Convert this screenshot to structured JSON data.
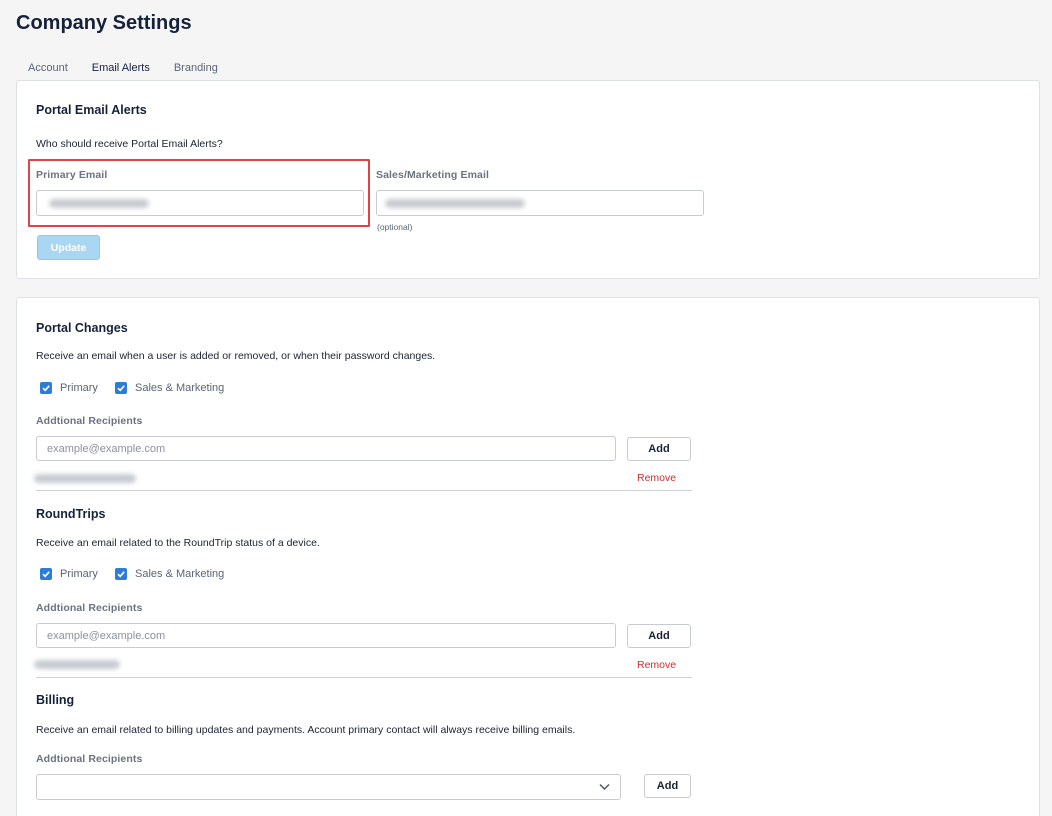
{
  "page": {
    "title": "Company Settings"
  },
  "tabs": [
    {
      "label": "Account",
      "active": false
    },
    {
      "label": "Email Alerts",
      "active": true
    },
    {
      "label": "Branding",
      "active": false
    }
  ],
  "portal_email_alerts": {
    "heading": "Portal Email Alerts",
    "question": "Who should receive Portal Email Alerts?",
    "primary_label": "Primary Email",
    "sales_label": "Sales/Marketing Email",
    "optional_note": "(optional)",
    "update_button": "Update"
  },
  "portal_changes": {
    "heading": "Portal Changes",
    "description": "Receive an email when a user is added or removed, or when their password changes.",
    "checkbox_primary": "Primary",
    "checkbox_sales": "Sales & Marketing",
    "recipients_label": "Addtional Recipients",
    "input_placeholder": "example@example.com",
    "add_button": "Add",
    "remove_link": "Remove"
  },
  "roundtrips": {
    "heading": "RoundTrips",
    "description": "Receive an email related to the RoundTrip status of a device.",
    "checkbox_primary": "Primary",
    "checkbox_sales": "Sales & Marketing",
    "recipients_label": "Addtional Recipients",
    "input_placeholder": "example@example.com",
    "add_button": "Add",
    "remove_link": "Remove"
  },
  "billing": {
    "heading": "Billing",
    "description": "Receive an email related to billing updates and payments. Account primary contact will always receive billing emails.",
    "recipients_label": "Addtional Recipients",
    "add_button": "Add"
  },
  "colors": {
    "accent": "#2f7fd8",
    "checkbox": "#2b7dd8",
    "remove": "#c9302c",
    "highlight": "#e04545",
    "update_disabled": "#a9d6f3"
  },
  "icons": {
    "checkbox": "check-icon",
    "select": "chevron-down-icon"
  }
}
